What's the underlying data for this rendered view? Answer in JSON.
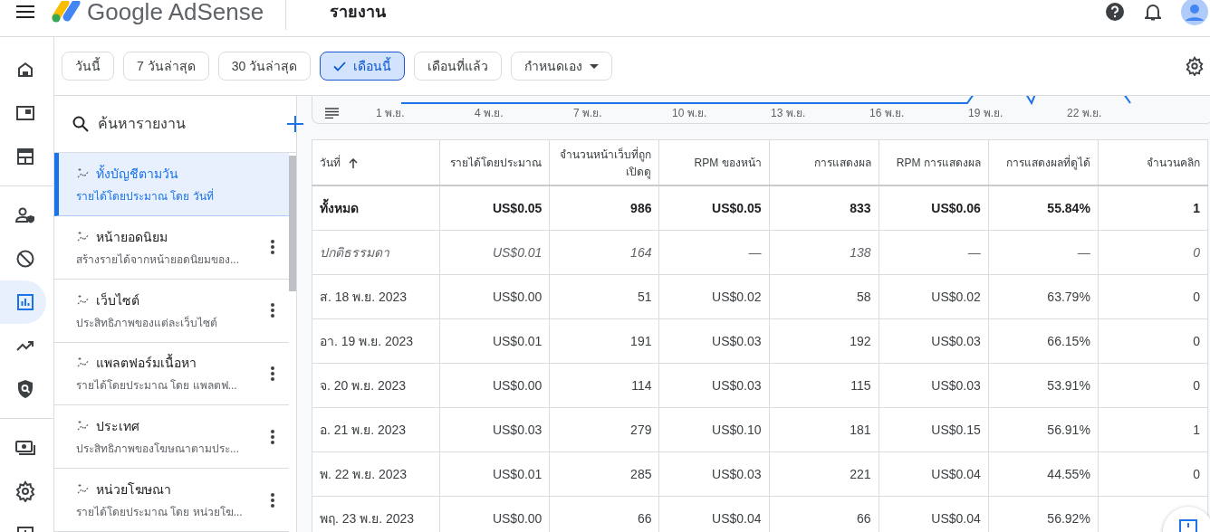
{
  "header": {
    "product": "Google AdSense",
    "page_title": "รายงาน"
  },
  "rail": {
    "groups": [
      [
        {
          "selected": false
        },
        {
          "selected": false
        },
        {
          "selected": false
        }
      ],
      [
        {
          "selected": false
        },
        {
          "selected": false
        },
        {
          "selected": true
        },
        {
          "selected": false
        },
        {
          "selected": false
        }
      ],
      [
        {
          "selected": false
        },
        {
          "selected": false
        },
        {
          "selected": false
        }
      ]
    ]
  },
  "date_filters": [
    {
      "label": "วันนี้",
      "selected": false,
      "dropdown": false
    },
    {
      "label": "7 วันล่าสุด",
      "selected": false,
      "dropdown": false
    },
    {
      "label": "30 วันล่าสุด",
      "selected": false,
      "dropdown": false
    },
    {
      "label": "เดือนนี้",
      "selected": true,
      "dropdown": false
    },
    {
      "label": "เดือนที่แล้ว",
      "selected": false,
      "dropdown": false
    },
    {
      "label": "กำหนดเอง",
      "selected": false,
      "dropdown": true
    }
  ],
  "reports": {
    "search_placeholder": "ค้นหารายงาน",
    "items": [
      {
        "title": "ทั้งบัญชีตามวัน",
        "subtitle": "รายได้โดยประมาณ โดย วันที่",
        "selected": true
      },
      {
        "title": "หน้ายอดนิยม",
        "subtitle": "สร้างรายได้จากหน้ายอดนิยมของ...",
        "selected": false
      },
      {
        "title": "เว็บไซต์",
        "subtitle": "ประสิทธิภาพของแต่ละเว็บไซต์",
        "selected": false
      },
      {
        "title": "แพลตฟอร์มเนื้อหา",
        "subtitle": "รายได้โดยประมาณ โดย แพลตฟ...",
        "selected": false
      },
      {
        "title": "ประเทศ",
        "subtitle": "ประสิทธิภาพของโฆษณาตามประ...",
        "selected": false
      },
      {
        "title": "หน่วยโฆษณา",
        "subtitle": "รายได้โดยประมาณ โดย หน่วยโฆ...",
        "selected": false
      }
    ]
  },
  "chart_x_labels": [
    "1 พ.ย.",
    "4 พ.ย.",
    "7 พ.ย.",
    "10 พ.ย.",
    "13 พ.ย.",
    "16 พ.ย.",
    "19 พ.ย.",
    "22 พ.ย."
  ],
  "table": {
    "columns": [
      {
        "label": "วันที่",
        "sorted": true
      },
      {
        "label": "รายได้โดยประมาณ",
        "sorted": false
      },
      {
        "label": "จำนวนหน้าเว็บที่ถูกเปิดดู",
        "sorted": false
      },
      {
        "label": "RPM ของหน้า",
        "sorted": false
      },
      {
        "label": "การแสดงผล",
        "sorted": false
      },
      {
        "label": "RPM การแสดงผล",
        "sorted": false
      },
      {
        "label": "การแสดงผลที่ดูได้",
        "sorted": false
      },
      {
        "label": "จำนวนคลิก",
        "sorted": false
      }
    ],
    "rows": [
      {
        "kind": "total",
        "cells": [
          "ทั้งหมด",
          "US$0.05",
          "986",
          "US$0.05",
          "833",
          "US$0.06",
          "55.84%",
          "1"
        ]
      },
      {
        "kind": "baseline",
        "cells": [
          "ปกติธรรมดา",
          "US$0.01",
          "164",
          "—",
          "138",
          "—",
          "—",
          "0"
        ]
      },
      {
        "kind": "day",
        "cells": [
          "ส. 18 พ.ย. 2023",
          "US$0.00",
          "51",
          "US$0.02",
          "58",
          "US$0.02",
          "63.79%",
          "0"
        ]
      },
      {
        "kind": "day",
        "cells": [
          "อา. 19 พ.ย. 2023",
          "US$0.01",
          "191",
          "US$0.03",
          "192",
          "US$0.03",
          "66.15%",
          "0"
        ]
      },
      {
        "kind": "day",
        "cells": [
          "จ. 20 พ.ย. 2023",
          "US$0.00",
          "114",
          "US$0.03",
          "115",
          "US$0.03",
          "53.91%",
          "0"
        ]
      },
      {
        "kind": "day",
        "cells": [
          "อ. 21 พ.ย. 2023",
          "US$0.03",
          "279",
          "US$0.10",
          "181",
          "US$0.15",
          "56.91%",
          "1"
        ]
      },
      {
        "kind": "day",
        "cells": [
          "พ. 22 พ.ย. 2023",
          "US$0.01",
          "285",
          "US$0.03",
          "221",
          "US$0.04",
          "44.55%",
          "0"
        ]
      },
      {
        "kind": "day",
        "cells": [
          "พฤ. 23 พ.ย. 2023",
          "US$0.00",
          "66",
          "US$0.04",
          "66",
          "US$0.04",
          "56.92%"
        ]
      }
    ]
  }
}
